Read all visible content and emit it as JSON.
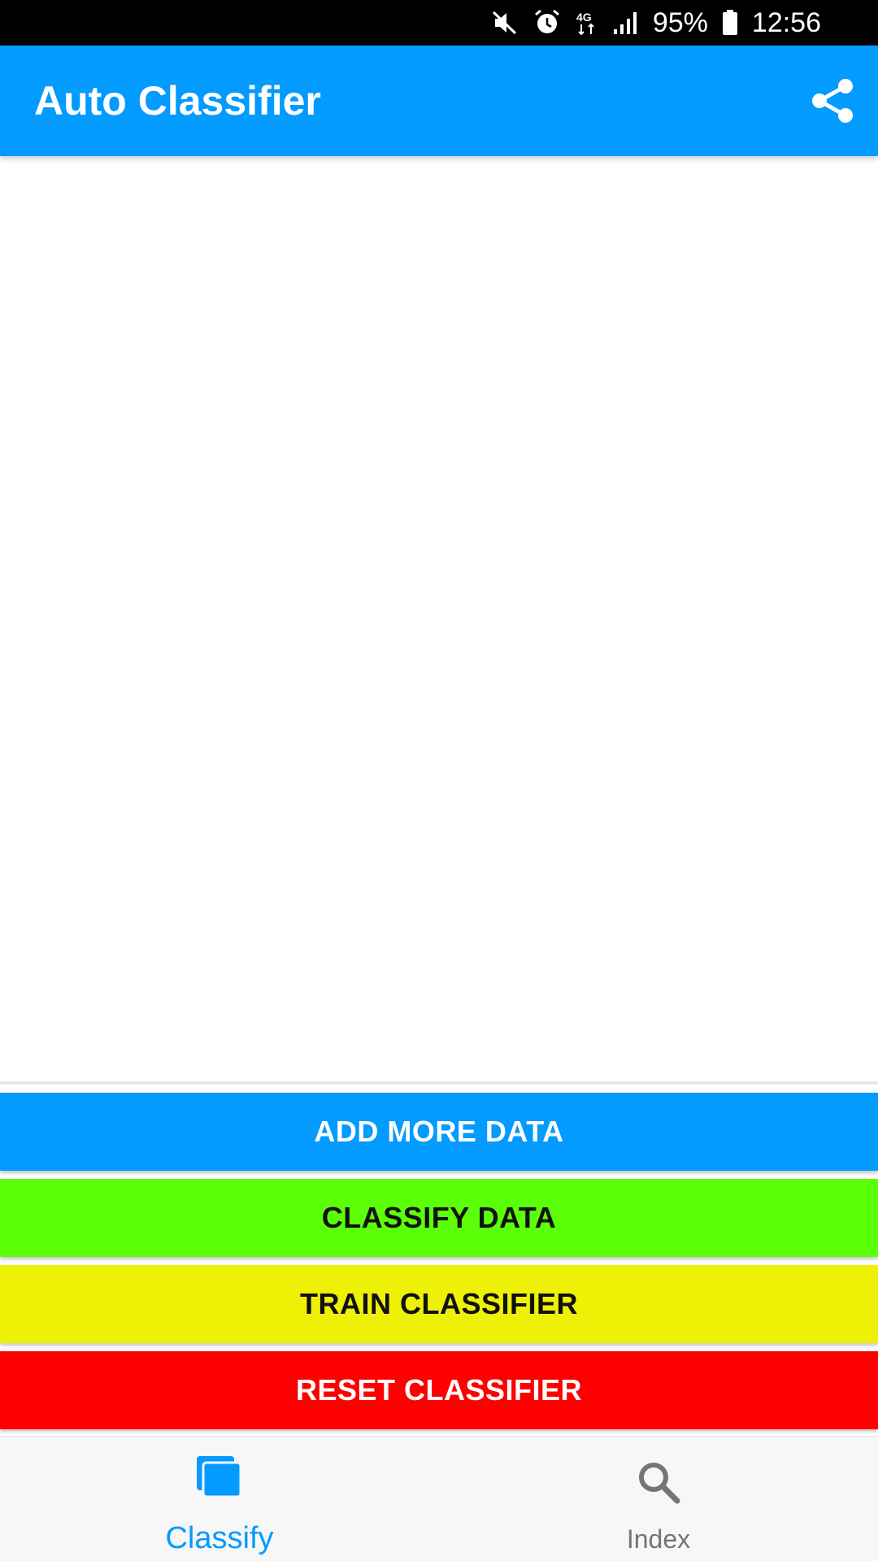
{
  "status_bar": {
    "network": "4G",
    "battery": "95%",
    "time": "12:56",
    "icons": [
      "mute-icon",
      "alarm-icon",
      "network-4g-icon",
      "signal-icon",
      "battery-icon"
    ]
  },
  "app_bar": {
    "title": "Auto Classifier",
    "share_icon": "share-icon"
  },
  "actions": {
    "add_more_data": "ADD MORE DATA",
    "classify_data": "CLASSIFY DATA",
    "train_classifier": "TRAIN CLASSIFIER",
    "reset_classifier": "RESET CLASSIFIER"
  },
  "bottom_nav": {
    "items": [
      {
        "label": "Classify",
        "icon": "classify-icon",
        "selected": true
      },
      {
        "label": "Index",
        "icon": "search-icon",
        "selected": false
      }
    ]
  },
  "colors": {
    "primary": "#039BFF",
    "classify_button": "#5BFF07",
    "train_button": "#EEF006",
    "reset_button": "#FF0000",
    "nav_inactive": "#757575"
  }
}
